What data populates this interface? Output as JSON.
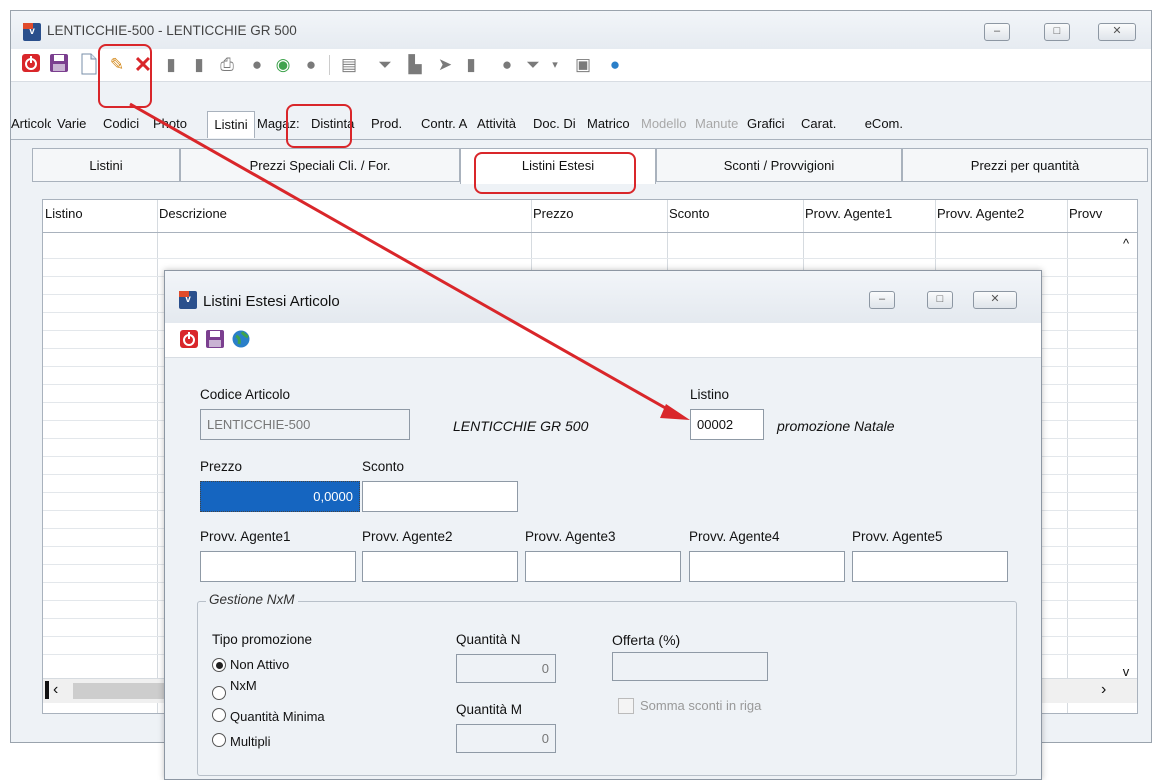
{
  "main_window": {
    "title": "LENTICCHIE-500 - LENTICCHIE GR 500",
    "controls": {
      "minimize": "–",
      "maximize": "□",
      "close": "✕"
    },
    "toolbar_icons": [
      "power-icon",
      "save-icon",
      "new-document-icon",
      "pencil-icon",
      "delete-icon",
      "doc-icon",
      "doc2-icon",
      "print-icon",
      "circle-icon",
      "green-circle-icon",
      "circle2-icon",
      "page-icon",
      "filter-icon",
      "chart-icon",
      "arrow-icon",
      "book-icon",
      "circle3-icon",
      "filter2-icon",
      "dropdown-icon",
      "image-icon",
      "globe-icon"
    ]
  },
  "tabs_top": [
    {
      "label": "Articolo",
      "disabled": false
    },
    {
      "label": "Varie",
      "disabled": false
    },
    {
      "label": "Codici",
      "disabled": false
    },
    {
      "label": "Photo",
      "disabled": false
    },
    {
      "label": "Listini",
      "disabled": false,
      "active": true
    },
    {
      "label": "Magaz:",
      "disabled": false
    },
    {
      "label": "Distinta",
      "disabled": false
    },
    {
      "label": "Prod.",
      "disabled": false
    },
    {
      "label": "Contr. A",
      "disabled": false
    },
    {
      "label": "Attività",
      "disabled": false
    },
    {
      "label": "Doc. Di",
      "disabled": false
    },
    {
      "label": "Matrico",
      "disabled": false
    },
    {
      "label": "Modello",
      "disabled": true
    },
    {
      "label": "Manute",
      "disabled": true
    },
    {
      "label": "Grafici",
      "disabled": false
    },
    {
      "label": "Carat.",
      "disabled": false
    },
    {
      "label": "eCom.",
      "disabled": false
    }
  ],
  "tabs_sub": [
    "Listini",
    "Prezzi Speciali Cli. / For.",
    "Listini Estesi",
    "Sconti / Provvigioni",
    "Prezzi per quantità"
  ],
  "grid": {
    "columns": [
      "Listino",
      "Descrizione",
      "Prezzo",
      "Sconto",
      "Provv. Agente1",
      "Provv. Agente2",
      "Provv"
    ],
    "scroll_left": "‹",
    "scroll_right": "›",
    "scroll_up": "^",
    "scroll_down": "v"
  },
  "dialog": {
    "title": "Listini Estesi Articolo",
    "labels": {
      "codice_articolo": "Codice Articolo",
      "listino": "Listino",
      "prezzo": "Prezzo",
      "sconto": "Sconto",
      "provv1": "Provv. Agente1",
      "provv2": "Provv. Agente2",
      "provv3": "Provv. Agente3",
      "provv4": "Provv. Agente4",
      "provv5": "Provv. Agente5"
    },
    "codice_articolo_value": "LENTICCHIE-500",
    "descrizione_articolo": "LENTICCHIE GR 500",
    "listino_value": "00002",
    "listino_descrizione": "promozione Natale",
    "prezzo_value": "0,0000",
    "sconto_value": "",
    "nxm": {
      "legend": "Gestione NxM",
      "tipo_label": "Tipo promozione",
      "options": [
        "Non Attivo",
        "NxM",
        "Quantità Minima",
        "Multipli"
      ],
      "selected": "Non Attivo",
      "quantita_n_label": "Quantità N",
      "quantita_n_value": "0",
      "quantita_m_label": "Quantità M",
      "quantita_m_value": "0",
      "offerta_label": "Offerta (%)",
      "offerta_value": "",
      "somma_sconti_label": "Somma sconti in riga"
    }
  },
  "annotation_color": "#d9262a"
}
